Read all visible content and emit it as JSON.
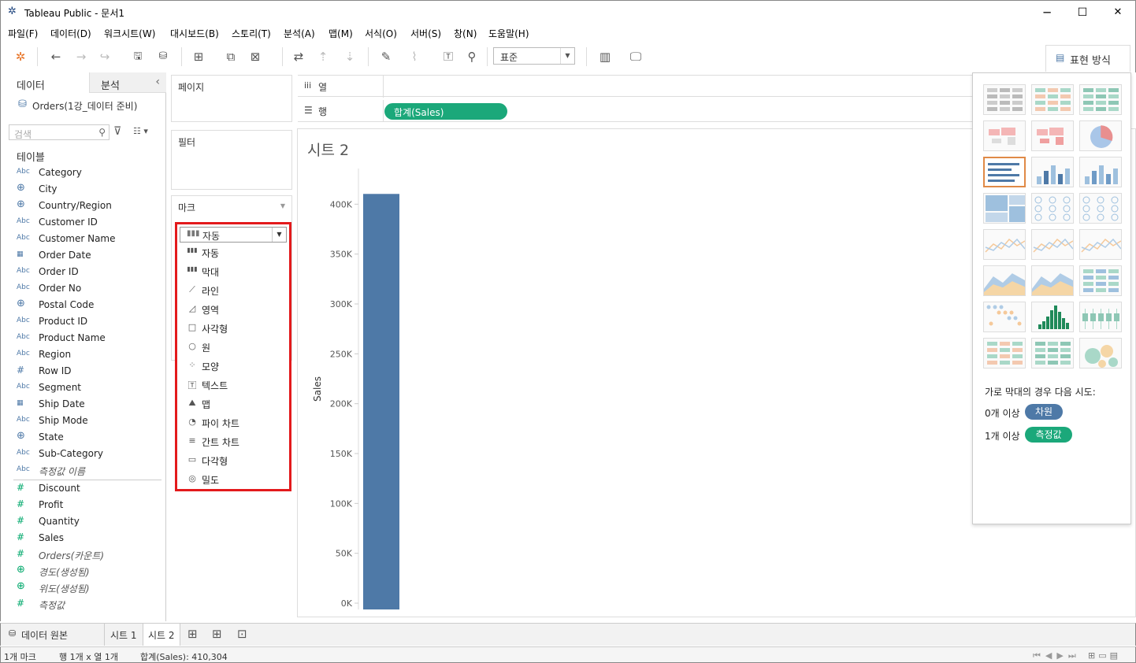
{
  "window": {
    "title": "Tableau Public - 문서1",
    "min": "─",
    "max": "☐",
    "close": "✕"
  },
  "menu": [
    "파일(F)",
    "데이터(D)",
    "워크시트(W)",
    "대시보드(B)",
    "스토리(T)",
    "분석(A)",
    "맵(M)",
    "서식(O)",
    "서버(S)",
    "창(N)",
    "도움말(H)"
  ],
  "toolbar": {
    "fit_value": "표준",
    "show_me_label": "표현 방식"
  },
  "left_pane": {
    "tab_data": "데이터",
    "tab_analysis": "분석",
    "datasource": "Orders(1강_데이터 준비)",
    "search_placeholder": "검색",
    "tables_label": "테이블",
    "dimensions": [
      {
        "icon": "Abc",
        "name": "Category"
      },
      {
        "icon": "geo",
        "name": "City"
      },
      {
        "icon": "geo",
        "name": "Country/Region"
      },
      {
        "icon": "Abc",
        "name": "Customer ID"
      },
      {
        "icon": "Abc",
        "name": "Customer Name"
      },
      {
        "icon": "date",
        "name": "Order Date"
      },
      {
        "icon": "Abc",
        "name": "Order ID"
      },
      {
        "icon": "Abc",
        "name": "Order No"
      },
      {
        "icon": "geo",
        "name": "Postal Code"
      },
      {
        "icon": "Abc",
        "name": "Product ID"
      },
      {
        "icon": "Abc",
        "name": "Product Name"
      },
      {
        "icon": "Abc",
        "name": "Region"
      },
      {
        "icon": "#",
        "name": "Row ID"
      },
      {
        "icon": "Abc",
        "name": "Segment"
      },
      {
        "icon": "date",
        "name": "Ship Date"
      },
      {
        "icon": "Abc",
        "name": "Ship Mode"
      },
      {
        "icon": "geo",
        "name": "State"
      },
      {
        "icon": "Abc",
        "name": "Sub-Category"
      },
      {
        "icon": "Abc",
        "name": "측정값 이름",
        "italic": true
      }
    ],
    "measures": [
      {
        "icon": "#",
        "name": "Discount"
      },
      {
        "icon": "#",
        "name": "Profit"
      },
      {
        "icon": "#",
        "name": "Quantity"
      },
      {
        "icon": "#",
        "name": "Sales"
      },
      {
        "icon": "#",
        "name": "Orders(카운트)",
        "italic": true
      },
      {
        "icon": "geo",
        "name": "경도(생성됨)",
        "italic": true
      },
      {
        "icon": "geo",
        "name": "위도(생성됨)",
        "italic": true
      },
      {
        "icon": "#",
        "name": "측정값",
        "italic": true
      }
    ]
  },
  "cards": {
    "pages": "페이지",
    "filters": "필터",
    "marks": "마크"
  },
  "marks_dropdown": {
    "selected": "자동",
    "options": [
      {
        "icon": "bar-auto-icon",
        "label": "자동"
      },
      {
        "icon": "bar-icon",
        "label": "막대"
      },
      {
        "icon": "line-icon",
        "label": "라인"
      },
      {
        "icon": "area-icon",
        "label": "영역"
      },
      {
        "icon": "square-icon",
        "label": "사각형"
      },
      {
        "icon": "circle-icon",
        "label": "원"
      },
      {
        "icon": "shape-icon",
        "label": "모양"
      },
      {
        "icon": "text-icon",
        "label": "텍스트"
      },
      {
        "icon": "map-icon",
        "label": "맵"
      },
      {
        "icon": "pie-icon",
        "label": "파이 차트"
      },
      {
        "icon": "gantt-icon",
        "label": "간트 차트"
      },
      {
        "icon": "polygon-icon",
        "label": "다각형"
      },
      {
        "icon": "density-icon",
        "label": "밀도"
      }
    ]
  },
  "shelves": {
    "columns_label": "열",
    "rows_label": "행",
    "rows_pill": "합계(Sales)"
  },
  "sheet_title": "시트 2",
  "chart_data": {
    "type": "bar",
    "categories": [
      ""
    ],
    "values": [
      410304
    ],
    "ylabel": "Sales",
    "ylim": [
      0,
      420000
    ],
    "yticks": [
      0,
      50000,
      100000,
      150000,
      200000,
      250000,
      300000,
      350000,
      400000
    ],
    "ytick_labels": [
      "0K",
      "50K",
      "100K",
      "150K",
      "200K",
      "250K",
      "300K",
      "350K",
      "400K"
    ],
    "bar_color": "#4e79a7",
    "grid": false
  },
  "show_me": {
    "hint": "가로 막대의 경우 다음 시도:",
    "req1_label": "0개 이상",
    "req1_pill": "차원",
    "req2_label": "1개 이상",
    "req2_pill": "측정값",
    "dim_color": "#4e79a7",
    "measure_color": "#1ba87a"
  },
  "sheet_tabs": {
    "datasource": "데이터 원본",
    "sheet1": "시트 1",
    "sheet2": "시트 2"
  },
  "status": {
    "marks": "1개 마크",
    "rowscols": "행 1개 x 열 1개",
    "sum": "합계(Sales): 410,304"
  }
}
